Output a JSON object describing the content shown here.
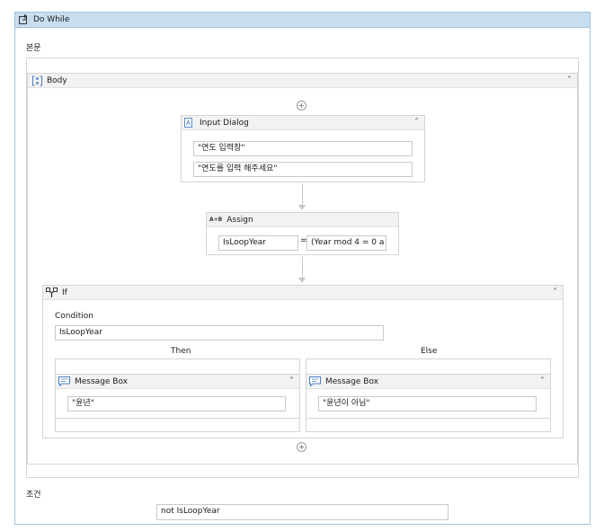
{
  "do_while": {
    "title": "Do While",
    "body_section_label": "본문",
    "condition_section_label": "조건",
    "condition_value": "not IsLoopYear"
  },
  "body": {
    "title": "Body"
  },
  "input_dialog": {
    "title": "Input Dialog",
    "title_field": "\"연도 입력창\"",
    "label_field": "\"연도를 입력 해주세요\""
  },
  "assign": {
    "title": "Assign",
    "icon_text": "A+B",
    "to_field": "IsLoopYear",
    "equals": "=",
    "value_field": "(Year mod 4 = 0 a"
  },
  "if_activity": {
    "title": "If",
    "condition_label": "Condition",
    "condition_value": "IsLoopYear",
    "then_label": "Then",
    "else_label": "Else"
  },
  "message_box_then": {
    "title": "Message Box",
    "text_field": "\"윤년\""
  },
  "message_box_else": {
    "title": "Message Box",
    "text_field": "\"윤년이 아님\""
  },
  "colors": {
    "header_blue": "#c7def0",
    "border_blue": "#9fc3e0"
  }
}
